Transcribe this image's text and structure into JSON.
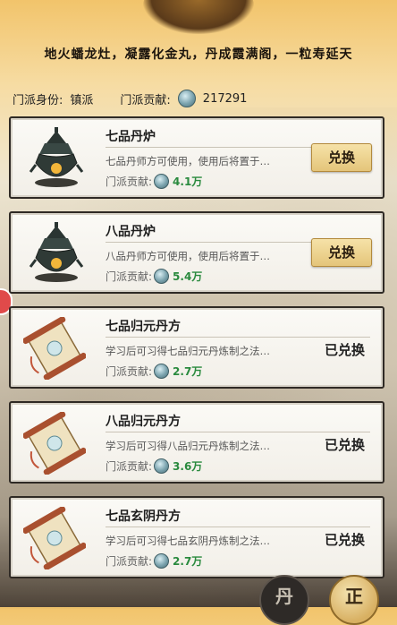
{
  "header": {
    "motto": "地火蟠龙灶，凝露化金丸，丹成霞满阁，一粒寿延天"
  },
  "info": {
    "identity_label": "门派身份:",
    "identity_value": "镇派",
    "contribution_label": "门派贡献:",
    "contribution_value": "217291",
    "contribution_icon": "sect-coin-icon"
  },
  "items": [
    {
      "name": "七品丹炉",
      "desc": "七品丹师方可使用，使用后将置于…",
      "cost_label": "门派贡献:",
      "cost": "4.1万",
      "action": "兑换",
      "status": "",
      "icon": "furnace-icon"
    },
    {
      "name": "八品丹炉",
      "desc": "八品丹师方可使用，使用后将置于…",
      "cost_label": "门派贡献:",
      "cost": "5.4万",
      "action": "兑换",
      "status": "",
      "icon": "furnace-icon"
    },
    {
      "name": "七品归元丹方",
      "desc": "学习后可习得七品归元丹炼制之法…",
      "cost_label": "门派贡献:",
      "cost": "2.7万",
      "action": "",
      "status": "已兑换",
      "icon": "scroll-icon"
    },
    {
      "name": "八品归元丹方",
      "desc": "学习后可习得八品归元丹炼制之法…",
      "cost_label": "门派贡献:",
      "cost": "3.6万",
      "action": "",
      "status": "已兑换",
      "icon": "scroll-icon"
    },
    {
      "name": "七品玄阴丹方",
      "desc": "学习后可习得七品玄阴丹炼制之法…",
      "cost_label": "门派贡献:",
      "cost": "2.7万",
      "action": "",
      "status": "已兑换",
      "icon": "scroll-icon"
    }
  ],
  "bottom": {
    "left_label": "丹",
    "right_label": "正"
  },
  "colors": {
    "cost_green": "#2a8a3e",
    "button_gold": "#e4c57a"
  }
}
